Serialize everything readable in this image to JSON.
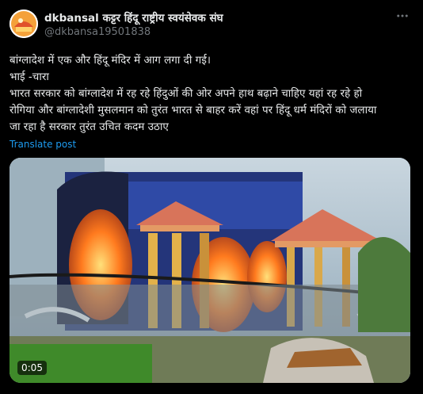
{
  "post": {
    "author_name": "dkbansal कट्टर हिंदू राष्ट्रीय स्वयंसेवक संघ",
    "handle": "@dkbansa19501838",
    "text_lines": [
      "बांग्लादेश में एक और हिंदू मंदिर में आग लगा दी गई।",
      "भाई -चारा",
      "भारत सरकार को बांग्लादेश में रह रहे हिंदुओं की ओर अपने हाथ बढ़ाने चाहिए यहां रह रहे हो",
      "रोगिया और बांग्लादेशी मुसलमान को तुरंत भारत से बाहर करें वहां पर हिंदू धर्म मंदिरों को जलाया",
      "जा रहा है सरकार तुरंत उचित कदम उठाए"
    ],
    "translate_label": "Translate post",
    "video_time": "0:05"
  },
  "colors": {
    "background": "#000000",
    "text": "#e7e9ea",
    "secondary_text": "#71767b",
    "link": "#1d9bf0",
    "fire": "#ff6a1a",
    "temple_roof": "#d8745a"
  },
  "icons": {
    "more": "more-horizontal-icon"
  }
}
